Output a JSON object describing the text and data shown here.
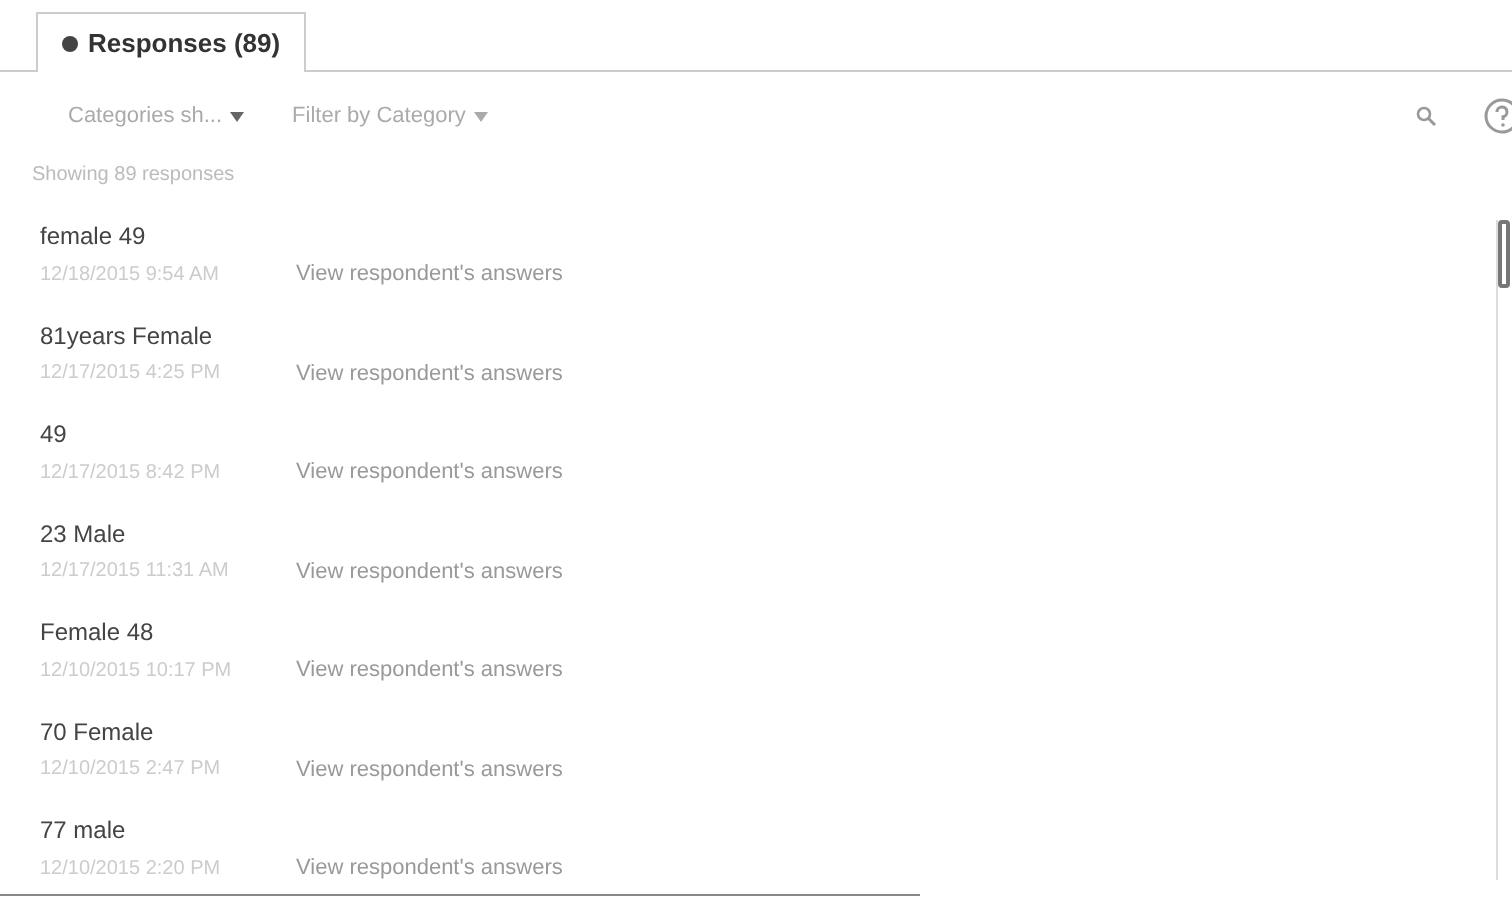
{
  "tabs": [
    {
      "label": "Responses (89)",
      "selected": true
    }
  ],
  "filters": [
    {
      "label": "Categories sh..."
    },
    {
      "label": "Filter by Category"
    }
  ],
  "summary": "Showing 89 responses",
  "responses": [
    {
      "title": "female 49",
      "date": "12/18/2015 9:54 AM",
      "link": "View respondent's answers"
    },
    {
      "title": "81years Female",
      "date": "12/17/2015 4:25 PM",
      "link": "View respondent's answers"
    },
    {
      "title": "49",
      "date": "12/17/2015 8:42 PM",
      "link": "View respondent's answers"
    },
    {
      "title": "23 Male",
      "date": "12/17/2015 11:31 AM",
      "link": "View respondent's answers"
    },
    {
      "title": "Female 48",
      "date": "12/10/2015 10:17 PM",
      "link": "View respondent's answers"
    },
    {
      "title": "70 Female",
      "date": "12/10/2015 2:47 PM",
      "link": "View respondent's answers"
    },
    {
      "title": "77 male",
      "date": "12/10/2015 2:20 PM",
      "link": "View respondent's answers"
    }
  ]
}
